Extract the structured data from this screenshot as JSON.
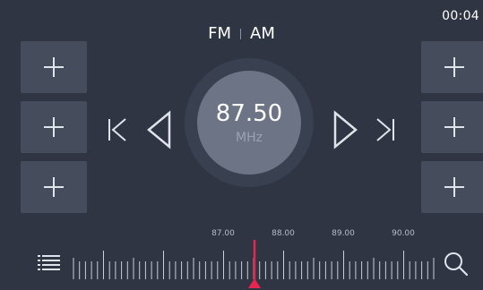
{
  "status_bar": {
    "time": "00:04"
  },
  "band_selector": {
    "fm_label": "FM",
    "am_label": "AM",
    "active": "FM"
  },
  "tuner": {
    "frequency": "87.50",
    "unit": "MHz"
  },
  "presets": {
    "left": [
      {
        "slot": 1
      },
      {
        "slot": 2
      },
      {
        "slot": 3
      }
    ],
    "right": [
      {
        "slot": 4
      },
      {
        "slot": 5
      },
      {
        "slot": 6
      }
    ]
  },
  "controls": {
    "prev_station_icon": "skip-previous-icon",
    "seek_down_icon": "seek-left-icon",
    "seek_up_icon": "seek-right-icon",
    "next_station_icon": "skip-next-icon",
    "list_icon": "list-icon",
    "search_icon": "search-icon",
    "preset_add_icon": "plus-icon"
  },
  "scale": {
    "labels": [
      "87.00",
      "88.00",
      "89.00",
      "90.00"
    ],
    "current_value": "87.50"
  },
  "colors": {
    "background": "#2f3542",
    "preset_button": "#454d5c",
    "dial_ring": "#394150",
    "dial_center": "#6c7486",
    "indicator": "#e8244f"
  }
}
